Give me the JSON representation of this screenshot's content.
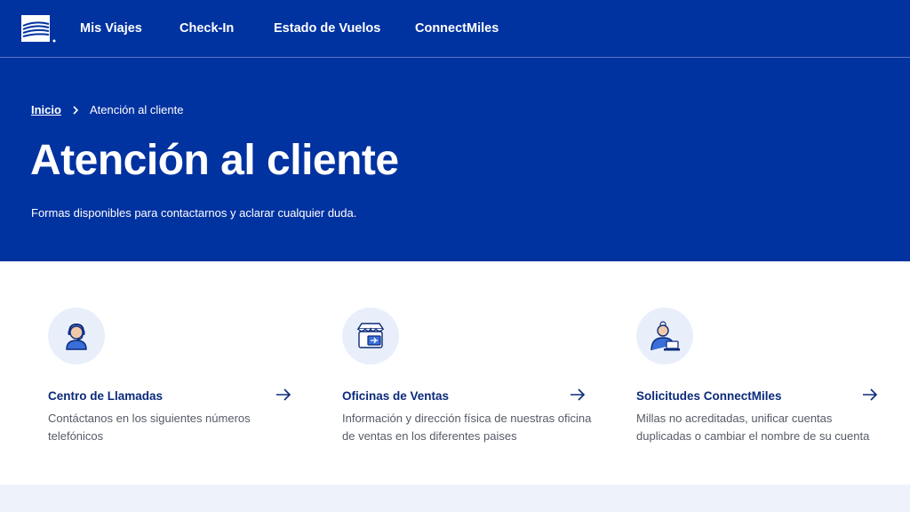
{
  "nav": {
    "logo_icon": "copa-logo-icon",
    "items": [
      {
        "label": "Mis Viajes"
      },
      {
        "label": "Check-In"
      },
      {
        "label": "Estado de Vuelos"
      },
      {
        "label": "ConnectMiles"
      }
    ]
  },
  "breadcrumb": {
    "home": "Inicio",
    "separator_icon": "chevron-right-icon",
    "current": "Atención al cliente"
  },
  "hero": {
    "title": "Atención al cliente",
    "subtitle": "Formas disponibles para contactarnos y aclarar cualquier duda."
  },
  "cards": [
    {
      "icon": "call-center-agent-icon",
      "title": "Centro de Llamadas",
      "description": "Contáctanos en los siguientes números telefónicos",
      "arrow_icon": "arrow-right-icon"
    },
    {
      "icon": "sales-office-icon",
      "title": "Oficinas de Ventas",
      "description": "Información y dirección física de nuestras oficina de ventas en los diferentes paises",
      "arrow_icon": "arrow-right-icon"
    },
    {
      "icon": "connectmiles-agent-icon",
      "title": "Solicitudes ConnectMiles",
      "description": "Millas no acreditadas, unificar cuentas duplicadas o cambiar el nombre de su cuenta",
      "arrow_icon": "arrow-right-icon"
    }
  ],
  "colors": {
    "brand_blue": "#0032a0",
    "title_blue": "#0b2a7a",
    "icon_bg": "#e9effa",
    "band_bg": "#eef3fb"
  }
}
